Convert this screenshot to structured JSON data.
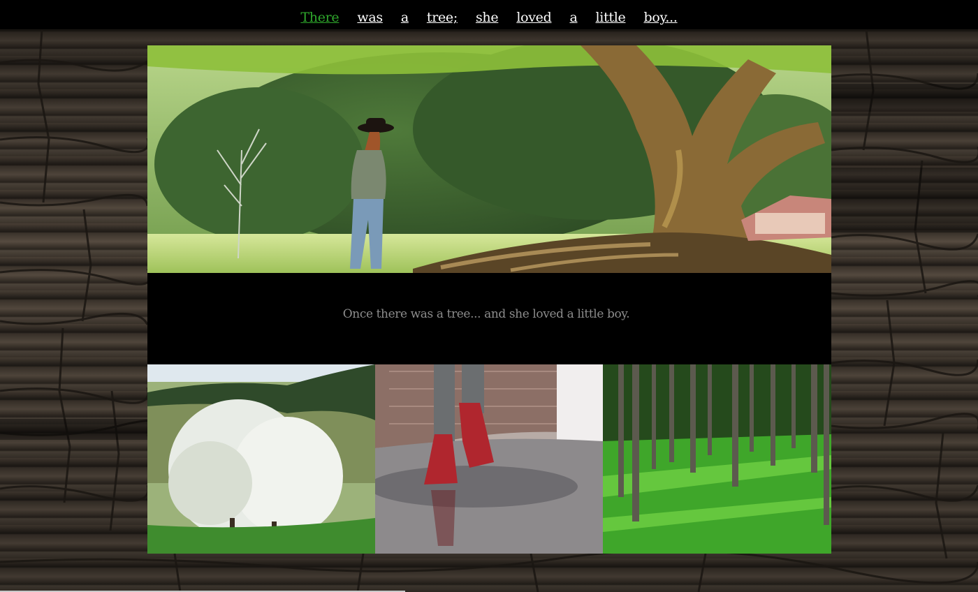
{
  "nav": {
    "items": [
      {
        "label": "There",
        "active": true
      },
      {
        "label": "was",
        "active": false
      },
      {
        "label": "a",
        "active": false
      },
      {
        "label": "tree;",
        "active": false
      },
      {
        "label": "she",
        "active": false
      },
      {
        "label": "loved",
        "active": false
      },
      {
        "label": "a",
        "active": false
      },
      {
        "label": "little",
        "active": false
      },
      {
        "label": "boy...",
        "active": false
      }
    ]
  },
  "main": {
    "caption": "Once there was a tree... and she loved a little boy."
  },
  "colors": {
    "active_link": "#2fa82c",
    "link": "#ffffff",
    "caption": "#8c8c8c",
    "panel": "#000000"
  }
}
